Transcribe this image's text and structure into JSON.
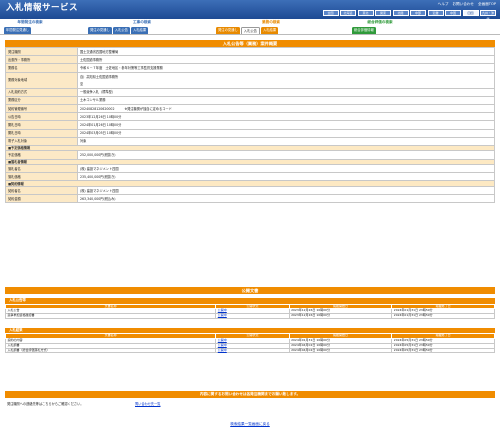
{
  "header": {
    "title": "入札情報サービス",
    "links": [
      "ヘルプ",
      "お問い合わせ",
      "全画面TOP"
    ],
    "regions": [
      "全国",
      "北海道",
      "東北",
      "関東",
      "北陸",
      "中部",
      "近畿",
      "中国",
      "四国",
      "九州・沖縄"
    ]
  },
  "nav": {
    "groups": [
      {
        "title": "年間発注の検索",
        "color": "#3a6fb5",
        "tabs": [
          "年間発注見通し"
        ]
      },
      {
        "title": "工事の検索",
        "color": "#3a6fb5",
        "tabs": [
          "発注の見通し",
          "入札公告",
          "入札結果"
        ]
      },
      {
        "title": "業務の検索",
        "color": "#e88a00",
        "tabs": [
          "発注の見通し",
          "入札公告",
          "入札結果"
        ]
      },
      {
        "title": "総合評価の検索",
        "color": "#2f9a3a",
        "tabs": [
          "総合評価情報"
        ]
      }
    ]
  },
  "notice": {
    "title": "入札公告等（業務）案件概要",
    "rows": [
      {
        "label": "発注機関",
        "value": "国土交通省四国地方整備局"
      },
      {
        "label": "出張所・事務所",
        "value": "土佐国道事務所"
      },
      {
        "label": "業務名",
        "value": "令和６－７年度　土佐地区・参年対策等工事監督支援業務"
      },
      {
        "label": "業務対象地域",
        "value": "自）高知県土佐国道事務所",
        "value2": "至"
      },
      {
        "label": "入札契約方式",
        "value": "一般競争入札（標準型）"
      },
      {
        "label": "業務区分",
        "value": "土木コンサル業務"
      },
      {
        "label": "契約管理番号",
        "value": "20240828120620002",
        "note": "※発注機関が独自に定めるコード"
      },
      {
        "label": "公告日時",
        "value": "2023年12月26日 10時00分"
      },
      {
        "label": "開札日時",
        "value": "2024年01月26日 10時00分"
      },
      {
        "label": "開札日時",
        "value": "2024年03月05日 10時00分"
      },
      {
        "label": "電子入札対象",
        "value": "対象"
      }
    ],
    "price_head": "■予定価格情報",
    "price_label": "予定価格",
    "price_value": "252,000,000円(税抜き)",
    "bidder_head": "■落札者情報",
    "bidder_rows": [
      {
        "label": "落札者名",
        "value": "(株) 建設マネジメント四国"
      },
      {
        "label": "落札価格",
        "value": "235,400,000円(税抜き)"
      }
    ],
    "contract_head": "■契約情報",
    "contract_rows": [
      {
        "label": "契約者名",
        "value": "(株) 建設マネジメント四国"
      },
      {
        "label": "契約金額",
        "value": "263,340,000円(税込み)"
      }
    ]
  },
  "docs": {
    "title": "公開文書",
    "headers": [
      "文書名称",
      "公開状況",
      "掲載開始日",
      "掲載終了日"
    ],
    "groups": [
      {
        "head": "入札公告等",
        "rows": [
          {
            "name": "入札公告",
            "status": "公開中",
            "start": "2023年12月26日 10時00分",
            "end": "2024年01月31日 23時59分"
          },
          {
            "name": "競争参加資格確認書",
            "status": "公開中",
            "start": "2023年12月26日 10時00分",
            "end": "2024年01月31日 23時59分"
          }
        ]
      },
      {
        "head": "入札結果",
        "rows": [
          {
            "name": "契約の内容",
            "status": "公開中",
            "start": "2024年01月31日 10時00分",
            "end": "2024年05月31日 23時59分"
          },
          {
            "name": "入札調書",
            "status": "公開中",
            "start": "2024年04月02日 10時00分",
            "end": "2024年05月31日 23時59分"
          },
          {
            "name": "入札調書（総合評価落札方式）",
            "status": "公開中",
            "start": "2024年04月02日 10時00分",
            "end": "2024年05月31日 23時59分"
          }
        ]
      }
    ]
  },
  "inquiry": {
    "bar": "内容に関するお問い合わせは各発注機関までお願い致します。",
    "text": "発注機関への連絡先等はこちらからご確認ください。",
    "link": "問い合わせ先一覧"
  },
  "back_link": "検索結果一覧画面に戻る"
}
